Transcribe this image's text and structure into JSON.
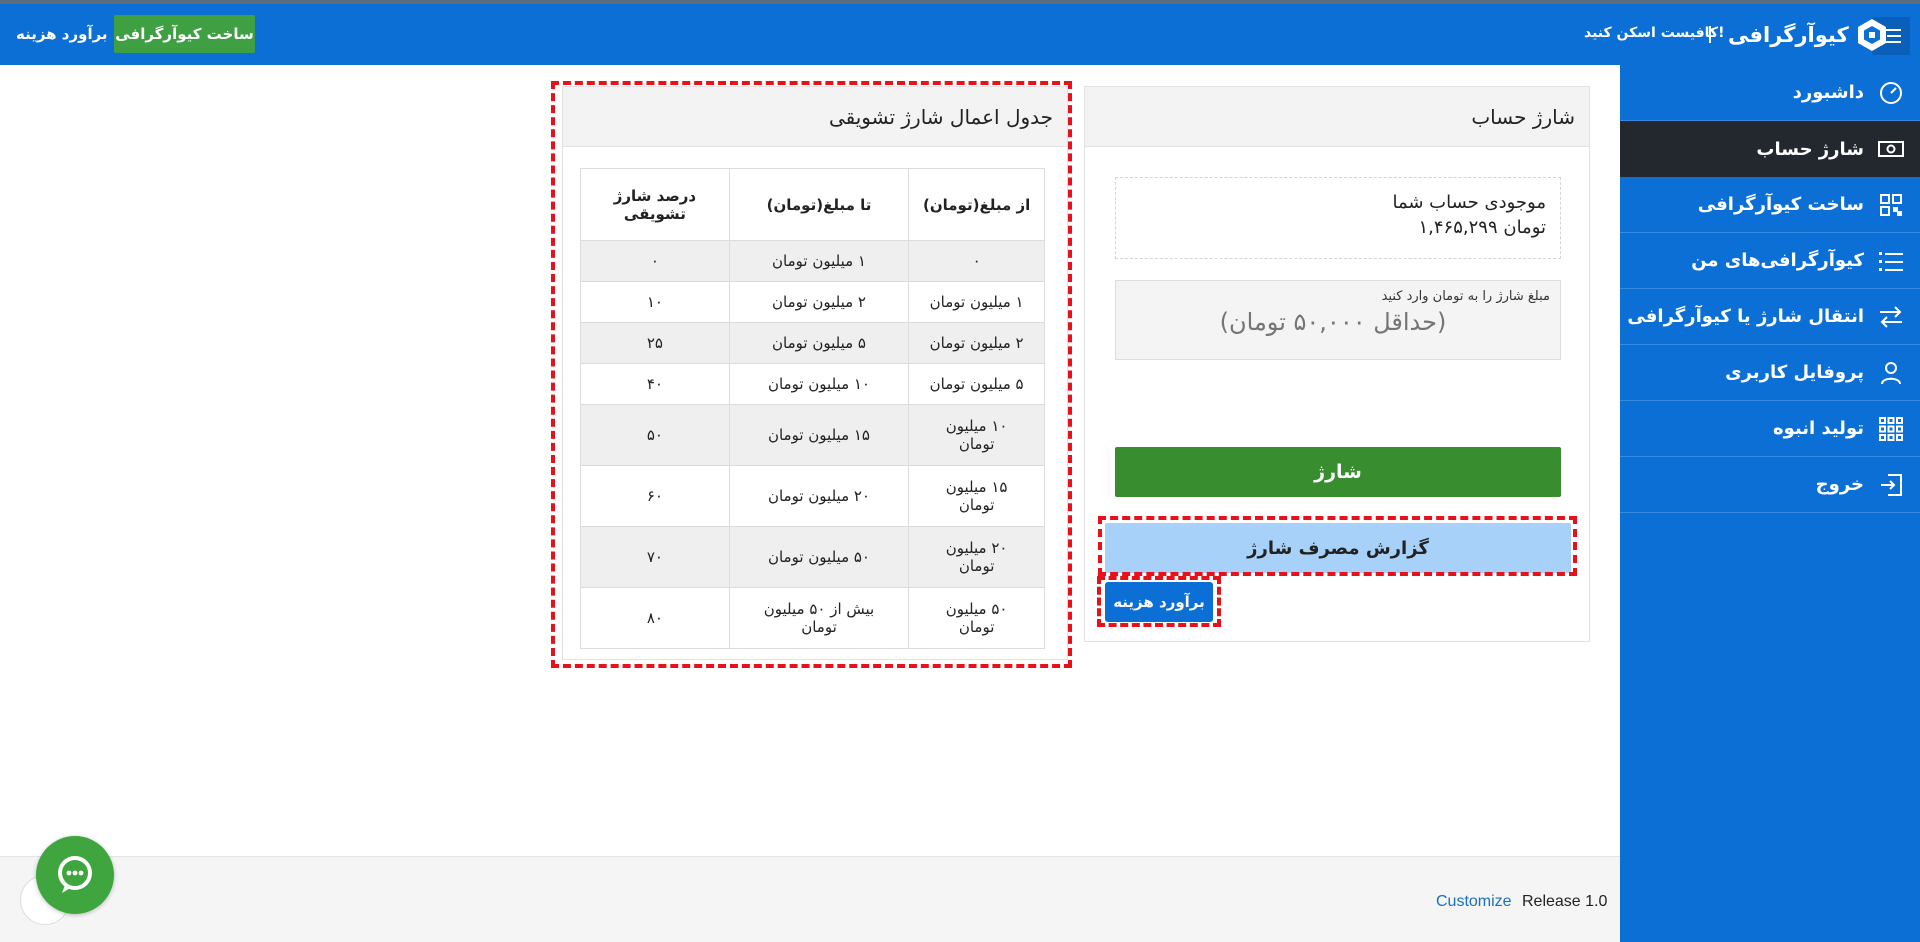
{
  "header": {
    "logo_text": "کیوآرگرافی",
    "tagline": "کافیست اسکن کنید!",
    "create_button": "ساخت کیوآرگرافی",
    "estimate_link": "برآورد هزینه"
  },
  "sidebar": {
    "items": [
      {
        "label": "داشبورد",
        "icon": "speedometer-icon"
      },
      {
        "label": "شارژ حساب",
        "icon": "money-icon"
      },
      {
        "label": "ساخت کیوآرگرافی",
        "icon": "qrcode-icon"
      },
      {
        "label": "کیوآرگرافی‌های من",
        "icon": "list-icon"
      },
      {
        "label": "انتقال شارژ یا کیوآرگرافی",
        "icon": "transfer-icon"
      },
      {
        "label": "پروفایل کاربری",
        "icon": "user-icon"
      },
      {
        "label": "تولید انبوه",
        "icon": "grid-icon"
      },
      {
        "label": "خروج",
        "icon": "logout-icon"
      }
    ]
  },
  "charge_panel": {
    "title": "شارژ حساب",
    "balance_label": "موجودی حساب شما",
    "balance_value": "۱,۴۶۵,۲۹۹ تومان",
    "amount_label": "مبلغ شارژ را به تومان وارد کنید",
    "amount_placeholder": "(حداقل ۵۰,۰۰۰ تومان)",
    "charge_button": "شارژ",
    "report_button": "گزارش مصرف شارژ",
    "estimate_button": "برآورد هزینه"
  },
  "bonus_panel": {
    "title": "جدول اعمال شارژ تشویقی",
    "columns": [
      "از مبلغ(تومان)",
      "تا مبلغ(تومان)",
      "درصد شارژ تشویقی"
    ],
    "rows": [
      [
        "۰",
        "۱ میلیون تومان",
        "۰"
      ],
      [
        "۱ میلیون تومان",
        "۲ میلیون تومان",
        "۱۰"
      ],
      [
        "۲ میلیون تومان",
        "۵ میلیون تومان",
        "۲۵"
      ],
      [
        "۵ میلیون تومان",
        "۱۰ میلیون تومان",
        "۴۰"
      ],
      [
        "۱۰ میلیون تومان",
        "۱۵ میلیون تومان",
        "۵۰"
      ],
      [
        "۱۵ میلیون تومان",
        "۲۰ میلیون تومان",
        "۶۰"
      ],
      [
        "۲۰ میلیون تومان",
        "۵۰ میلیون تومان",
        "۷۰"
      ],
      [
        "۵۰ میلیون تومان",
        "بیش از ۵۰ میلیون تومان",
        "۸۰"
      ]
    ]
  },
  "footer": {
    "release": "Release 1.0",
    "customize": "Customize"
  }
}
